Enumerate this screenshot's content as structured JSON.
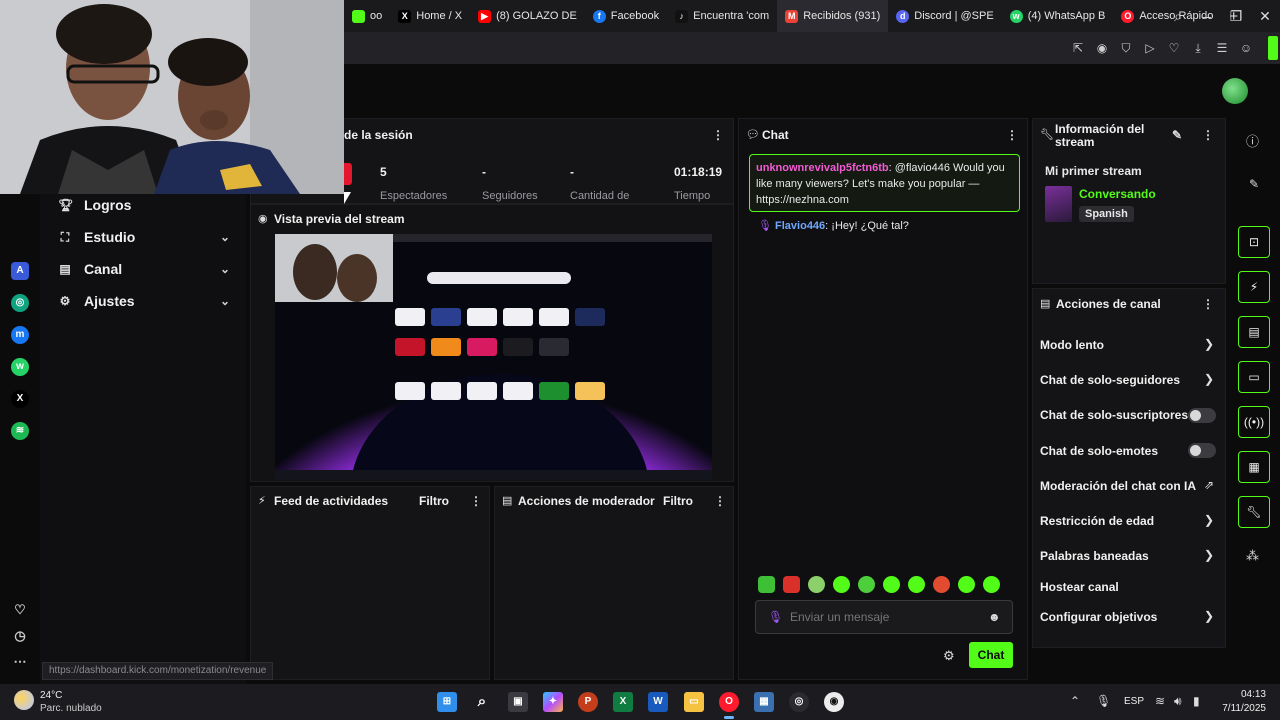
{
  "browser": {
    "tabs": [
      {
        "label": "oo",
        "favicon": "kick-icon",
        "color": "#53fc18"
      },
      {
        "label": "Home / X",
        "favicon": "x-icon",
        "color": "#000000"
      },
      {
        "label": "(8) GOLAZO DE",
        "favicon": "youtube-icon",
        "color": "#ff0000"
      },
      {
        "label": "Facebook",
        "favicon": "facebook-icon",
        "color": "#1877f2"
      },
      {
        "label": "Encuentra 'com",
        "favicon": "tiktok-icon",
        "color": "#111111"
      },
      {
        "label": "Recibidos (931)",
        "favicon": "gmail-icon",
        "color": "#ea4335"
      },
      {
        "label": "Discord | @SPE",
        "favicon": "discord-icon",
        "color": "#5865f2"
      },
      {
        "label": "(4) WhatsApp B",
        "favicon": "whatsapp-icon",
        "color": "#25d366"
      },
      {
        "label": "Acceso Rápido",
        "favicon": "opera-icon",
        "color": "#ff1b2d"
      }
    ],
    "new_tab": "+"
  },
  "session": {
    "title": "de la sesión",
    "badge": "0",
    "stats": [
      {
        "value": "5",
        "label": "Espectadores"
      },
      {
        "value": "-",
        "label": "Seguidores"
      },
      {
        "value": "-",
        "label": "Cantidad de"
      },
      {
        "value": "01:18:19",
        "label": "Tiempo"
      }
    ]
  },
  "nav": {
    "items": [
      {
        "label": "Logros",
        "icon": "trophy-icon",
        "has_chevron": false
      },
      {
        "label": "Estudio",
        "icon": "studio-icon",
        "has_chevron": true
      },
      {
        "label": "Canal",
        "icon": "channel-icon",
        "has_chevron": true
      },
      {
        "label": "Ajustes",
        "icon": "gear-icon",
        "has_chevron": true
      }
    ]
  },
  "preview": {
    "title": "Vista previa del stream"
  },
  "activity": {
    "title": "Feed de actividades",
    "filter": "Filtro"
  },
  "moderator": {
    "title": "Acciones de moderador",
    "filter": "Filtro"
  },
  "chat": {
    "title": "Chat",
    "messages": [
      {
        "user": "unknownrevivalp5fctn6tb",
        "text": ": @flavio446 Would you like many viewers? Let's make you popular — https://nezhna.com"
      },
      {
        "user": "Flavio446",
        "text": ": ¡Hey! ¿Qué tal?"
      }
    ],
    "input_placeholder": "Enviar un mensaje",
    "send_label": "Chat"
  },
  "stream_info": {
    "title": "Información del stream",
    "stream_title": "Mi primer stream",
    "category": "Conversando",
    "language": "Spanish"
  },
  "channel_actions": {
    "title": "Acciones de canal",
    "items": [
      {
        "label": "Modo lento",
        "control": "chevron"
      },
      {
        "label": "Chat de solo-seguidores",
        "control": "chevron"
      },
      {
        "label": "Chat de solo-suscriptores",
        "control": "toggle"
      },
      {
        "label": "Chat de solo-emotes",
        "control": "toggle"
      },
      {
        "label": "Moderación del chat con IA",
        "control": "external"
      },
      {
        "label": "Restricción de edad",
        "control": "chevron"
      },
      {
        "label": "Palabras baneadas",
        "control": "chevron"
      },
      {
        "label": "Hostear canal",
        "control": "none"
      },
      {
        "label": "Configurar objetivos",
        "control": "chevron"
      }
    ]
  },
  "status_url": "https://dashboard.kick.com/monetization/revenue",
  "taskbar": {
    "weather_temp": "24°C",
    "weather_desc": "Parc. nublado",
    "lang": "ESP",
    "time": "04:13",
    "date": "7/11/2025"
  },
  "colors": {
    "accent": "#53fc18",
    "chat_user": "#f35ad6"
  }
}
